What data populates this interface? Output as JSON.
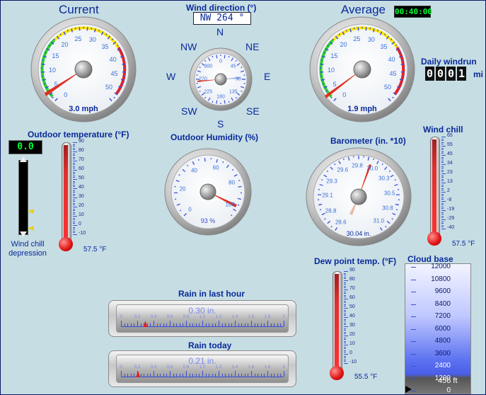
{
  "current": {
    "title": "Current",
    "readout": "3.0 mph",
    "value": 3.0,
    "max": 60,
    "ticks": [
      "0",
      "5",
      "10",
      "15",
      "20",
      "25",
      "30",
      "35",
      "40",
      "45",
      "50"
    ]
  },
  "average": {
    "title": "Average",
    "readout": "1.9 mph",
    "value": 1.9,
    "max": 60,
    "timer": "00:40:00",
    "ticks": [
      "0",
      "5",
      "10",
      "15",
      "20",
      "25",
      "30",
      "35",
      "40",
      "45",
      "50"
    ]
  },
  "wind_direction": {
    "title": "Wind direction (°)",
    "readout": "NW  264 °",
    "degrees": 264,
    "compass": {
      "n": "N",
      "ne": "NE",
      "e": "E",
      "se": "SE",
      "s": "S",
      "sw": "SW",
      "w": "W",
      "nw": "NW"
    },
    "ticks": [
      "0",
      "45",
      "90",
      "135",
      "180",
      "225",
      "270",
      "300"
    ]
  },
  "windrun": {
    "title": "Daily windrun",
    "digits": [
      "0",
      "0",
      "0",
      "1"
    ],
    "unit": "mi"
  },
  "outdoor_temperature": {
    "title": "Outdoor temperature (°F)",
    "readout": "57.5 °F",
    "value": 57.5,
    "scale": [
      "90",
      "80",
      "70",
      "60",
      "50",
      "40",
      "30",
      "20",
      "10",
      "0",
      "-10"
    ]
  },
  "wind_chill_depression": {
    "label": "Wind chill depression",
    "value": "0.0"
  },
  "humidity": {
    "title": "Outdoor Humidity (%)",
    "readout": "93 %",
    "value": 93,
    "ticks": [
      "0",
      "20",
      "40",
      "60",
      "80",
      "100"
    ]
  },
  "barometer": {
    "title": "Barometer (in. *10)",
    "readout": "30.04 in.",
    "value": 300.4,
    "ticks": [
      "28.6",
      "28.8",
      "29.1",
      "29.3",
      "29.6",
      "29.8",
      "30.0",
      "30.3",
      "30.5",
      "30.8",
      "31.0"
    ]
  },
  "wind_chill": {
    "title": "Wind chill",
    "readout": "57.5 °F",
    "value": 57.5,
    "scale": [
      "65",
      "55",
      "45",
      "34",
      "23",
      "13",
      "2",
      "-8",
      "-19",
      "-29",
      "-40"
    ]
  },
  "dew_point": {
    "title": "Dew point temp. (°F)",
    "readout": "55.5 °F",
    "value": 55.5,
    "scale": [
      "90",
      "80",
      "70",
      "60",
      "50",
      "40",
      "30",
      "20",
      "10",
      "0",
      "-10"
    ]
  },
  "rain_hour": {
    "title": "Rain in last hour",
    "readout": "0.30 in.",
    "value": 0.3,
    "ticks": [
      "0",
      "0.2",
      "0.4",
      "0.6",
      "0.8",
      "1.0",
      "1.2",
      "1.4",
      "1.6",
      "1.8",
      "2"
    ]
  },
  "rain_today": {
    "title": "Rain today",
    "readout": "0.21 in.",
    "value": 0.21,
    "ticks": [
      "0",
      "0.2",
      "0.4",
      "0.6",
      "0.8",
      "1.0",
      "1.2",
      "1.4",
      "1.6",
      "1.8",
      "2"
    ]
  },
  "cloud_base": {
    "title": "Cloud base",
    "readout": "456 ft",
    "value": 456,
    "scale": [
      "12000",
      "10800",
      "9600",
      "8400",
      "7200",
      "6000",
      "4800",
      "3600",
      "2400",
      "1200",
      "0"
    ]
  },
  "colors": {
    "accent_blue": "#0a2a9a",
    "needle_red": "#e03020",
    "lcd_green": "#00ff33"
  }
}
